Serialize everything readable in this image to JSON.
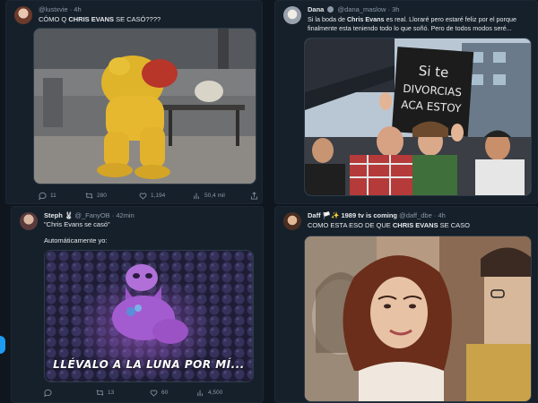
{
  "posts": [
    {
      "user": "@lustxvie",
      "time": "· 4h",
      "text_pre": "CÓMO Q ",
      "text_bold": "CHRIS EVANS",
      "text_post": " SE CASÓ????",
      "replies": "11",
      "reposts": "280",
      "likes": "1,194",
      "views": "50,4 mil"
    },
    {
      "name": "Dana",
      "handle": "@dana_maslow",
      "time": "· 3h",
      "text_pre": "Si la boda de ",
      "text_bold": "Chris Evans",
      "text_post": " es real. Lloraré pero estaré feliz por el porque finalmente esta teniendo todo lo que soñó. Pero de todos modos seré...",
      "sign_text": "Si te DIVORCIAS ACA ESTOY"
    },
    {
      "name": "Steph",
      "handle": "@_FanyOB",
      "time": "· 42min",
      "text_line1": "\"Chris Evans se casó\"",
      "text_line2": "Automáticamente yo:",
      "caption": "LLÉVALO A LA LUNA POR MÍ...",
      "replies": "",
      "reposts": "13",
      "likes": "60",
      "views": "4,500"
    },
    {
      "name": "Daff",
      "extra": "1989 tv is coming",
      "handle": "@daff_dbe",
      "time": "· 4h",
      "text_pre": "COMO ESTA ESO DE QUE ",
      "text_bold": "CHRIS EVANS",
      "text_post": " SE CASO"
    }
  ],
  "colors": {
    "background": "#10161d",
    "card": "#15202b",
    "accent": "#1d9bf0",
    "muted": "#8b98a5"
  },
  "icons": [
    "reply-icon",
    "repost-icon",
    "like-icon",
    "views-icon",
    "share-icon",
    "verified-icon"
  ]
}
